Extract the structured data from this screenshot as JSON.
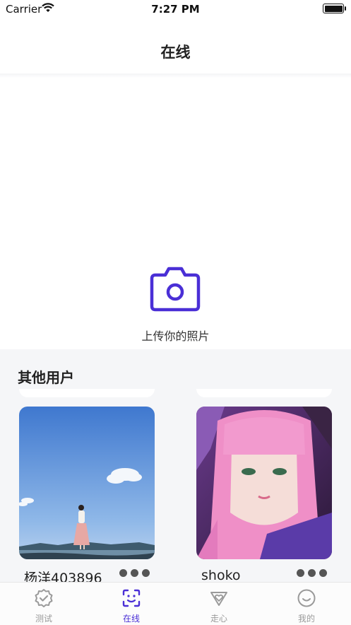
{
  "status_bar": {
    "carrier": "Carrier",
    "time": "7:27 PM"
  },
  "header": {
    "title": "在线"
  },
  "upload": {
    "label": "上传你的照片",
    "icon": "camera-icon"
  },
  "others": {
    "heading": "其他用户",
    "users": [
      {
        "name": "杨洋403896"
      },
      {
        "name": "shoko"
      }
    ]
  },
  "tabbar": {
    "items": [
      {
        "label": "测试",
        "icon": "badge-check-icon"
      },
      {
        "label": "在线",
        "icon": "face-scan-icon",
        "active": true
      },
      {
        "label": "走心",
        "icon": "heart-diamond-icon"
      },
      {
        "label": "我的",
        "icon": "smile-icon"
      }
    ]
  },
  "colors": {
    "accent": "#4a2fd6",
    "muted": "#9a9a9a",
    "section_bg": "#f5f6f8"
  }
}
